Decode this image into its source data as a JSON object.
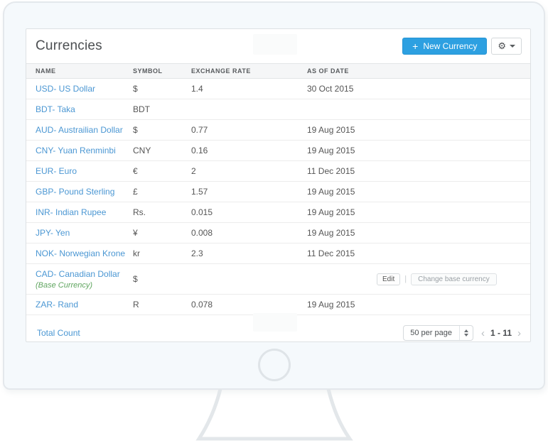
{
  "header": {
    "title": "Currencies",
    "new_currency_button": {
      "plus": "+",
      "label": "New Currency"
    },
    "gear_icon": "gear"
  },
  "table": {
    "columns": [
      "NAME",
      "SYMBOL",
      "EXCHANGE RATE",
      "AS OF DATE"
    ],
    "rows": [
      {
        "name": "USD- US Dollar",
        "symbol": "$",
        "rate": "1.4",
        "date": "30 Oct 2015"
      },
      {
        "name": "BDT- Taka",
        "symbol": "BDT",
        "rate": "",
        "date": ""
      },
      {
        "name": "AUD- Austrailian Dollar",
        "symbol": "$",
        "rate": "0.77",
        "date": "19 Aug 2015"
      },
      {
        "name": "CNY- Yuan Renminbi",
        "symbol": "CNY",
        "rate": "0.16",
        "date": "19 Aug 2015"
      },
      {
        "name": "EUR- Euro",
        "symbol": "€",
        "rate": "2",
        "date": "11 Dec 2015"
      },
      {
        "name": "GBP- Pound Sterling",
        "symbol": "£",
        "rate": "1.57",
        "date": "19 Aug 2015"
      },
      {
        "name": "INR- Indian Rupee",
        "symbol": "Rs.",
        "rate": "0.015",
        "date": "19 Aug 2015"
      },
      {
        "name": "JPY- Yen",
        "symbol": "¥",
        "rate": "0.008",
        "date": "19 Aug 2015"
      },
      {
        "name": "NOK- Norwegian Krone",
        "symbol": "kr",
        "rate": "2.3",
        "date": "11 Dec 2015"
      },
      {
        "name": "CAD- Canadian Dollar",
        "note": "(Base Currency)",
        "symbol": "$",
        "rate": "",
        "date": "",
        "actions": [
          "Edit",
          "Change base currency"
        ]
      },
      {
        "name": "ZAR- Rand",
        "symbol": "R",
        "rate": "0.078",
        "date": "19 Aug 2015"
      }
    ]
  },
  "footer": {
    "total_count_label": "Total Count",
    "per_page": "50 per page",
    "range": "1 - 11",
    "prev_icon": "‹",
    "next_icon": "›"
  },
  "colors": {
    "accent_blue": "#2da0e1",
    "link_blue": "#4b97d3",
    "base_currency_green": "#5fa55f",
    "bezel": "#f5f9fc"
  }
}
